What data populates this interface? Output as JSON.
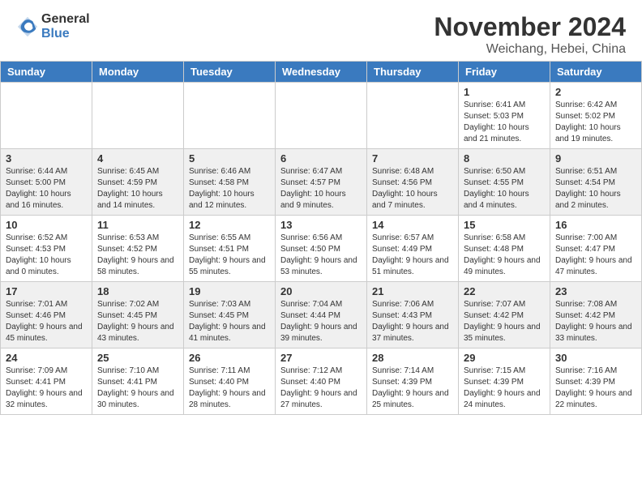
{
  "header": {
    "logo": {
      "general": "General",
      "blue": "Blue"
    },
    "title": "November 2024",
    "location": "Weichang, Hebei, China"
  },
  "weekdays": [
    "Sunday",
    "Monday",
    "Tuesday",
    "Wednesday",
    "Thursday",
    "Friday",
    "Saturday"
  ],
  "weeks": [
    [
      {
        "day": "",
        "info": ""
      },
      {
        "day": "",
        "info": ""
      },
      {
        "day": "",
        "info": ""
      },
      {
        "day": "",
        "info": ""
      },
      {
        "day": "",
        "info": ""
      },
      {
        "day": "1",
        "info": "Sunrise: 6:41 AM\nSunset: 5:03 PM\nDaylight: 10 hours and 21 minutes."
      },
      {
        "day": "2",
        "info": "Sunrise: 6:42 AM\nSunset: 5:02 PM\nDaylight: 10 hours and 19 minutes."
      }
    ],
    [
      {
        "day": "3",
        "info": "Sunrise: 6:44 AM\nSunset: 5:00 PM\nDaylight: 10 hours and 16 minutes."
      },
      {
        "day": "4",
        "info": "Sunrise: 6:45 AM\nSunset: 4:59 PM\nDaylight: 10 hours and 14 minutes."
      },
      {
        "day": "5",
        "info": "Sunrise: 6:46 AM\nSunset: 4:58 PM\nDaylight: 10 hours and 12 minutes."
      },
      {
        "day": "6",
        "info": "Sunrise: 6:47 AM\nSunset: 4:57 PM\nDaylight: 10 hours and 9 minutes."
      },
      {
        "day": "7",
        "info": "Sunrise: 6:48 AM\nSunset: 4:56 PM\nDaylight: 10 hours and 7 minutes."
      },
      {
        "day": "8",
        "info": "Sunrise: 6:50 AM\nSunset: 4:55 PM\nDaylight: 10 hours and 4 minutes."
      },
      {
        "day": "9",
        "info": "Sunrise: 6:51 AM\nSunset: 4:54 PM\nDaylight: 10 hours and 2 minutes."
      }
    ],
    [
      {
        "day": "10",
        "info": "Sunrise: 6:52 AM\nSunset: 4:53 PM\nDaylight: 10 hours and 0 minutes."
      },
      {
        "day": "11",
        "info": "Sunrise: 6:53 AM\nSunset: 4:52 PM\nDaylight: 9 hours and 58 minutes."
      },
      {
        "day": "12",
        "info": "Sunrise: 6:55 AM\nSunset: 4:51 PM\nDaylight: 9 hours and 55 minutes."
      },
      {
        "day": "13",
        "info": "Sunrise: 6:56 AM\nSunset: 4:50 PM\nDaylight: 9 hours and 53 minutes."
      },
      {
        "day": "14",
        "info": "Sunrise: 6:57 AM\nSunset: 4:49 PM\nDaylight: 9 hours and 51 minutes."
      },
      {
        "day": "15",
        "info": "Sunrise: 6:58 AM\nSunset: 4:48 PM\nDaylight: 9 hours and 49 minutes."
      },
      {
        "day": "16",
        "info": "Sunrise: 7:00 AM\nSunset: 4:47 PM\nDaylight: 9 hours and 47 minutes."
      }
    ],
    [
      {
        "day": "17",
        "info": "Sunrise: 7:01 AM\nSunset: 4:46 PM\nDaylight: 9 hours and 45 minutes."
      },
      {
        "day": "18",
        "info": "Sunrise: 7:02 AM\nSunset: 4:45 PM\nDaylight: 9 hours and 43 minutes."
      },
      {
        "day": "19",
        "info": "Sunrise: 7:03 AM\nSunset: 4:45 PM\nDaylight: 9 hours and 41 minutes."
      },
      {
        "day": "20",
        "info": "Sunrise: 7:04 AM\nSunset: 4:44 PM\nDaylight: 9 hours and 39 minutes."
      },
      {
        "day": "21",
        "info": "Sunrise: 7:06 AM\nSunset: 4:43 PM\nDaylight: 9 hours and 37 minutes."
      },
      {
        "day": "22",
        "info": "Sunrise: 7:07 AM\nSunset: 4:42 PM\nDaylight: 9 hours and 35 minutes."
      },
      {
        "day": "23",
        "info": "Sunrise: 7:08 AM\nSunset: 4:42 PM\nDaylight: 9 hours and 33 minutes."
      }
    ],
    [
      {
        "day": "24",
        "info": "Sunrise: 7:09 AM\nSunset: 4:41 PM\nDaylight: 9 hours and 32 minutes."
      },
      {
        "day": "25",
        "info": "Sunrise: 7:10 AM\nSunset: 4:41 PM\nDaylight: 9 hours and 30 minutes."
      },
      {
        "day": "26",
        "info": "Sunrise: 7:11 AM\nSunset: 4:40 PM\nDaylight: 9 hours and 28 minutes."
      },
      {
        "day": "27",
        "info": "Sunrise: 7:12 AM\nSunset: 4:40 PM\nDaylight: 9 hours and 27 minutes."
      },
      {
        "day": "28",
        "info": "Sunrise: 7:14 AM\nSunset: 4:39 PM\nDaylight: 9 hours and 25 minutes."
      },
      {
        "day": "29",
        "info": "Sunrise: 7:15 AM\nSunset: 4:39 PM\nDaylight: 9 hours and 24 minutes."
      },
      {
        "day": "30",
        "info": "Sunrise: 7:16 AM\nSunset: 4:39 PM\nDaylight: 9 hours and 22 minutes."
      }
    ]
  ]
}
